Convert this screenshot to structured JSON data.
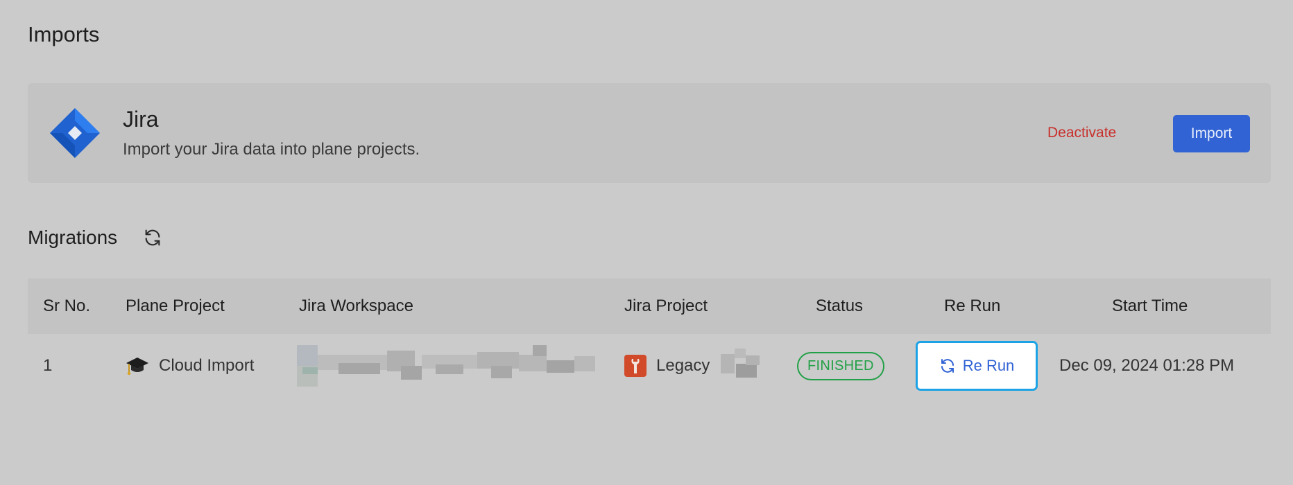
{
  "page": {
    "title": "Imports"
  },
  "integration": {
    "name": "Jira",
    "description": "Import your Jira data into plane projects.",
    "deactivate_label": "Deactivate",
    "import_label": "Import",
    "logo_icon": "jira-logo-icon"
  },
  "migrations": {
    "title": "Migrations",
    "refresh_icon": "refresh-icon",
    "columns": [
      "Sr No.",
      "Plane Project",
      "Jira Workspace",
      "Jira Project",
      "Status",
      "Re Run",
      "Start Time"
    ],
    "rows": [
      {
        "sr_no": "1",
        "plane_project": "Cloud Import",
        "plane_project_icon": "graduation-cap-icon",
        "jira_workspace": "",
        "jira_project": "Legacy",
        "jira_project_icon": "wrench-icon",
        "status": "FINISHED",
        "rerun_label": "Re Run",
        "start_time": "Dec 09, 2024 01:28 PM"
      }
    ]
  },
  "colors": {
    "background": "#cbcbcb",
    "card_background": "#c3c3c3",
    "accent": "#3163d4",
    "danger": "#c8302c",
    "success": "#22a047",
    "focus_ring": "#1ca3e6"
  }
}
